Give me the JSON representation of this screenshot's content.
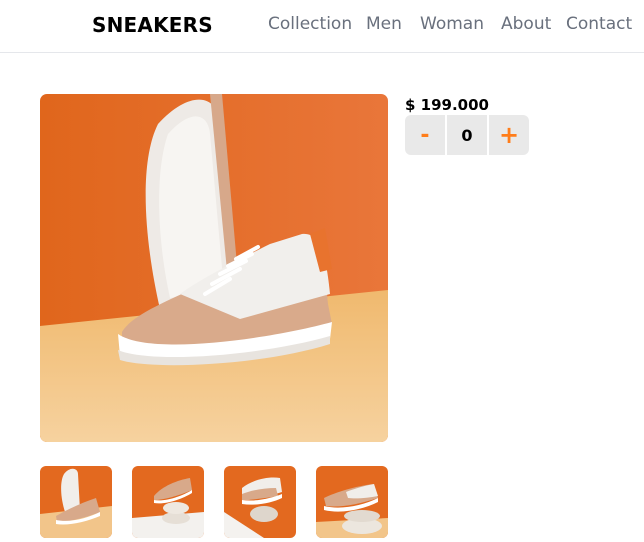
{
  "header": {
    "logo": "SNEAKERS",
    "nav": [
      "Collection",
      "Men",
      "Woman",
      "About",
      "Contact"
    ]
  },
  "product": {
    "price": "$ 199.000",
    "quantity": {
      "minus_label": "-",
      "value": "0",
      "plus_label": "+"
    }
  },
  "gallery": {
    "main_image": "sneaker-product-image",
    "thumbnails": [
      "sneaker-thumbnail-1",
      "sneaker-thumbnail-2",
      "sneaker-thumbnail-3",
      "sneaker-thumbnail-4"
    ]
  },
  "colors": {
    "accent": "#ff7d1a",
    "background_orange": "#e4691f",
    "floor_beige": "#f2c58a",
    "nav_text": "#69707d",
    "qty_bg": "#e9e9e9"
  }
}
